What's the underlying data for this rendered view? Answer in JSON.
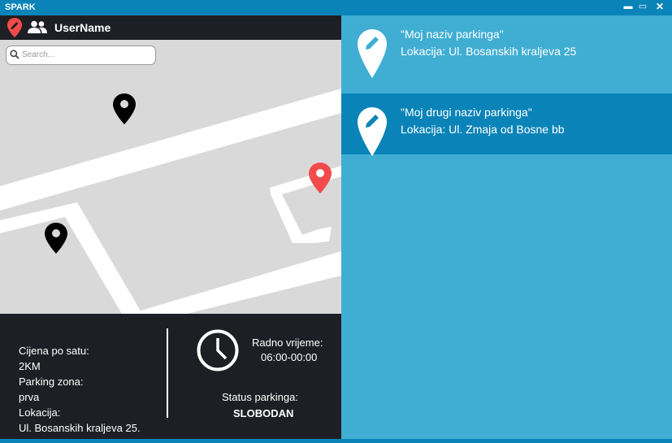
{
  "window": {
    "title": "SPARK",
    "min_label": "▬",
    "max_label": "▭",
    "close_label": "✕"
  },
  "userbar": {
    "username": "UserName"
  },
  "search": {
    "placeholder": "Search..."
  },
  "details": {
    "price_label": "Cijena po satu:",
    "price_value": "2KM",
    "zone_label": "Parking zona:",
    "zone_value": "prva",
    "location_label": "Lokacija:",
    "location_value": "Ul. Bosanskih kraljeva 25.",
    "hours_label": "Radno vrijeme:",
    "hours_value": "06:00-00:00",
    "status_label": "Status parkinga:",
    "status_value": "SLOBODAN"
  },
  "parking_list": [
    {
      "name": "\"Moj naziv parkinga\"",
      "location": "Lokacija: Ul. Bosanskih kraljeva 25",
      "selected": false
    },
    {
      "name": "\"Moj drugi naziv parkinga\"",
      "location": "Lokacija: Ul. Zmaja od Bosne bb",
      "selected": true
    }
  ],
  "colors": {
    "accent": "#0a84b8",
    "list_bg": "#40aed3",
    "dark": "#1e1f24",
    "pin_red": "#f24b4b",
    "map_bg": "#d9d9d9"
  },
  "icons": [
    "logo-pin-icon",
    "users-icon",
    "search-icon",
    "map-pin-icon",
    "clock-icon",
    "edit-pin-icon"
  ]
}
